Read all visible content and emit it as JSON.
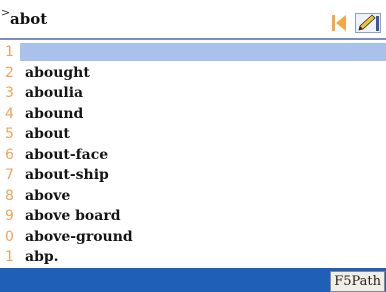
{
  "input": {
    "caret": ">",
    "text": "abot",
    "prev_icon": "prev-arrow-icon",
    "edit_icon": "pencil-icon"
  },
  "candidates": [
    {
      "num": "1",
      "word": "",
      "selected": true
    },
    {
      "num": "2",
      "word": "abought"
    },
    {
      "num": "3",
      "word": "aboulia"
    },
    {
      "num": "4",
      "word": "abound"
    },
    {
      "num": "5",
      "word": "about"
    },
    {
      "num": "6",
      "word": "about-face"
    },
    {
      "num": "7",
      "word": "about-ship"
    },
    {
      "num": "8",
      "word": "above"
    },
    {
      "num": "9",
      "word": "above board"
    },
    {
      "num": "0",
      "word": "above-ground"
    },
    {
      "num": "1",
      "word": "abp."
    }
  ],
  "statusbar": {
    "button_label": "F5Path"
  },
  "colors": {
    "accent": "#1f5fb8",
    "selection": "#a9c1ec",
    "number": "#f0a45a"
  }
}
